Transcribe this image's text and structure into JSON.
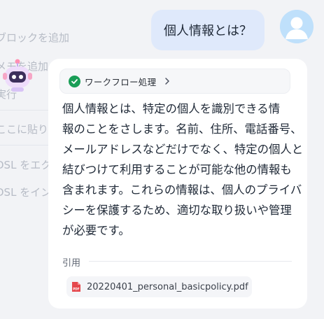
{
  "background_menu": {
    "items": [
      "ブロックを追加",
      "メモを追加",
      "実行",
      "ここに貼り付け",
      "DSL をエクスポート",
      "DSL をインポート"
    ]
  },
  "user_message": {
    "text": "個人情報とは？"
  },
  "assistant": {
    "workflow": {
      "label": "ワークフロー処理",
      "status": "success"
    },
    "answer_lines": [
      "個人情報とは、特定の個人を識別できる情",
      "報のことをさします。名前、住所、電話番号、",
      "メールアドレスなどだけでなく、特定の個人と",
      "結びつけて利用することが可能な他の情報も",
      "含まれます。これらの情報は、個人のプライバ",
      "シーを保護するため、適切な取り扱いや管理",
      "が必要です。"
    ],
    "citation": {
      "label": "引用",
      "file": "20220401_personal_basicpolicy.pdf",
      "file_icon": "pdf-icon"
    }
  },
  "colors": {
    "success": "#1a9e57",
    "user_bubble": "#dfe9fb",
    "pdf_red": "#e5484d"
  }
}
